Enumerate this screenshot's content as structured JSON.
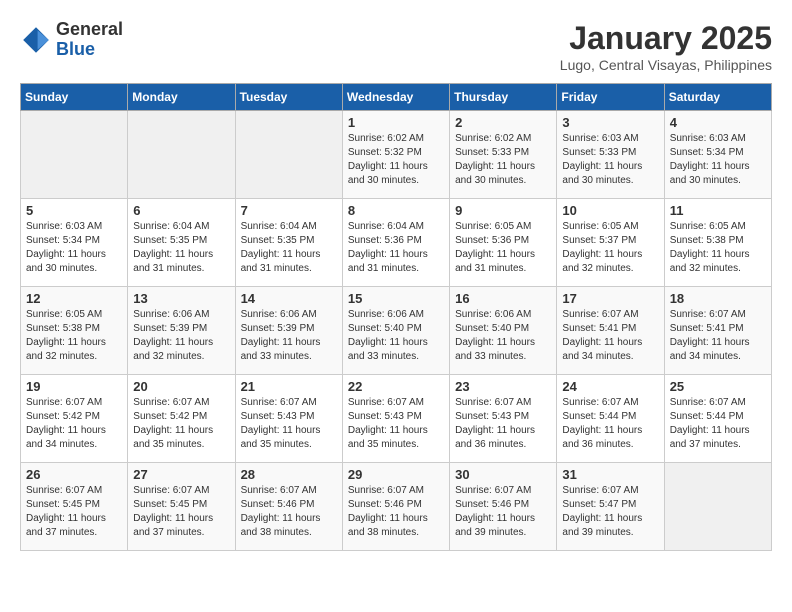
{
  "logo": {
    "line1": "General",
    "line2": "Blue"
  },
  "title": "January 2025",
  "location": "Lugo, Central Visayas, Philippines",
  "days_of_week": [
    "Sunday",
    "Monday",
    "Tuesday",
    "Wednesday",
    "Thursday",
    "Friday",
    "Saturday"
  ],
  "weeks": [
    [
      {
        "day": "",
        "info": ""
      },
      {
        "day": "",
        "info": ""
      },
      {
        "day": "",
        "info": ""
      },
      {
        "day": "1",
        "info": "Sunrise: 6:02 AM\nSunset: 5:32 PM\nDaylight: 11 hours and 30 minutes."
      },
      {
        "day": "2",
        "info": "Sunrise: 6:02 AM\nSunset: 5:33 PM\nDaylight: 11 hours and 30 minutes."
      },
      {
        "day": "3",
        "info": "Sunrise: 6:03 AM\nSunset: 5:33 PM\nDaylight: 11 hours and 30 minutes."
      },
      {
        "day": "4",
        "info": "Sunrise: 6:03 AM\nSunset: 5:34 PM\nDaylight: 11 hours and 30 minutes."
      }
    ],
    [
      {
        "day": "5",
        "info": "Sunrise: 6:03 AM\nSunset: 5:34 PM\nDaylight: 11 hours and 30 minutes."
      },
      {
        "day": "6",
        "info": "Sunrise: 6:04 AM\nSunset: 5:35 PM\nDaylight: 11 hours and 31 minutes."
      },
      {
        "day": "7",
        "info": "Sunrise: 6:04 AM\nSunset: 5:35 PM\nDaylight: 11 hours and 31 minutes."
      },
      {
        "day": "8",
        "info": "Sunrise: 6:04 AM\nSunset: 5:36 PM\nDaylight: 11 hours and 31 minutes."
      },
      {
        "day": "9",
        "info": "Sunrise: 6:05 AM\nSunset: 5:36 PM\nDaylight: 11 hours and 31 minutes."
      },
      {
        "day": "10",
        "info": "Sunrise: 6:05 AM\nSunset: 5:37 PM\nDaylight: 11 hours and 32 minutes."
      },
      {
        "day": "11",
        "info": "Sunrise: 6:05 AM\nSunset: 5:38 PM\nDaylight: 11 hours and 32 minutes."
      }
    ],
    [
      {
        "day": "12",
        "info": "Sunrise: 6:05 AM\nSunset: 5:38 PM\nDaylight: 11 hours and 32 minutes."
      },
      {
        "day": "13",
        "info": "Sunrise: 6:06 AM\nSunset: 5:39 PM\nDaylight: 11 hours and 32 minutes."
      },
      {
        "day": "14",
        "info": "Sunrise: 6:06 AM\nSunset: 5:39 PM\nDaylight: 11 hours and 33 minutes."
      },
      {
        "day": "15",
        "info": "Sunrise: 6:06 AM\nSunset: 5:40 PM\nDaylight: 11 hours and 33 minutes."
      },
      {
        "day": "16",
        "info": "Sunrise: 6:06 AM\nSunset: 5:40 PM\nDaylight: 11 hours and 33 minutes."
      },
      {
        "day": "17",
        "info": "Sunrise: 6:07 AM\nSunset: 5:41 PM\nDaylight: 11 hours and 34 minutes."
      },
      {
        "day": "18",
        "info": "Sunrise: 6:07 AM\nSunset: 5:41 PM\nDaylight: 11 hours and 34 minutes."
      }
    ],
    [
      {
        "day": "19",
        "info": "Sunrise: 6:07 AM\nSunset: 5:42 PM\nDaylight: 11 hours and 34 minutes."
      },
      {
        "day": "20",
        "info": "Sunrise: 6:07 AM\nSunset: 5:42 PM\nDaylight: 11 hours and 35 minutes."
      },
      {
        "day": "21",
        "info": "Sunrise: 6:07 AM\nSunset: 5:43 PM\nDaylight: 11 hours and 35 minutes."
      },
      {
        "day": "22",
        "info": "Sunrise: 6:07 AM\nSunset: 5:43 PM\nDaylight: 11 hours and 35 minutes."
      },
      {
        "day": "23",
        "info": "Sunrise: 6:07 AM\nSunset: 5:43 PM\nDaylight: 11 hours and 36 minutes."
      },
      {
        "day": "24",
        "info": "Sunrise: 6:07 AM\nSunset: 5:44 PM\nDaylight: 11 hours and 36 minutes."
      },
      {
        "day": "25",
        "info": "Sunrise: 6:07 AM\nSunset: 5:44 PM\nDaylight: 11 hours and 37 minutes."
      }
    ],
    [
      {
        "day": "26",
        "info": "Sunrise: 6:07 AM\nSunset: 5:45 PM\nDaylight: 11 hours and 37 minutes."
      },
      {
        "day": "27",
        "info": "Sunrise: 6:07 AM\nSunset: 5:45 PM\nDaylight: 11 hours and 37 minutes."
      },
      {
        "day": "28",
        "info": "Sunrise: 6:07 AM\nSunset: 5:46 PM\nDaylight: 11 hours and 38 minutes."
      },
      {
        "day": "29",
        "info": "Sunrise: 6:07 AM\nSunset: 5:46 PM\nDaylight: 11 hours and 38 minutes."
      },
      {
        "day": "30",
        "info": "Sunrise: 6:07 AM\nSunset: 5:46 PM\nDaylight: 11 hours and 39 minutes."
      },
      {
        "day": "31",
        "info": "Sunrise: 6:07 AM\nSunset: 5:47 PM\nDaylight: 11 hours and 39 minutes."
      },
      {
        "day": "",
        "info": ""
      }
    ]
  ]
}
